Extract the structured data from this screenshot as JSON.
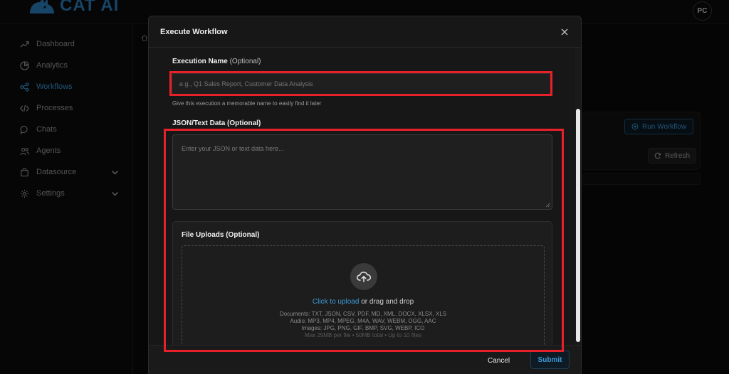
{
  "app": {
    "brand": "CAT AI",
    "avatar_initials": "PC",
    "accent_color": "#3b9ad9",
    "highlight_color": "#e8202a"
  },
  "sidebar": {
    "items": [
      {
        "label": "Dashboard",
        "icon": "trend-up-icon",
        "active": false
      },
      {
        "label": "Analytics",
        "icon": "pie-chart-icon",
        "active": false
      },
      {
        "label": "Workflows",
        "icon": "share-nodes-icon",
        "active": true
      },
      {
        "label": "Processes",
        "icon": "code-icon",
        "active": false
      },
      {
        "label": "Chats",
        "icon": "chat-bubble-icon",
        "active": false
      },
      {
        "label": "Agents",
        "icon": "users-icon",
        "active": false
      },
      {
        "label": "Datasource",
        "icon": "database-bag-icon",
        "active": false,
        "expandable": true
      },
      {
        "label": "Settings",
        "icon": "gear-icon",
        "active": false,
        "expandable": true
      }
    ]
  },
  "background": {
    "run_workflow_label": "Run Workflow",
    "refresh_label": "Refresh"
  },
  "modal": {
    "title": "Execute Workflow",
    "execution_name": {
      "label": "Execution Name",
      "optional": "(Optional)",
      "placeholder": "e.g., Q1 Sales Report, Customer Data Analysis",
      "value": "",
      "hint": "Give this execution a memorable name to easily find it later"
    },
    "json_data": {
      "label": "JSON/Text Data (Optional)",
      "placeholder": "Enter your JSON or text data here...",
      "value": ""
    },
    "file_uploads": {
      "label": "File Uploads (Optional)",
      "click_text": "Click to upload",
      "drag_text": " or drag and drop",
      "documents": "Documents: TXT, JSON, CSV, PDF, MD, XML, DOCX, XLSX, XLS",
      "audio": "Audio: MP3, MP4, MPEG, M4A, WAV, WEBM, OGG, AAC",
      "images": "Images: JPG, PNG, GIF, BMP, SVG, WEBP, ICO",
      "limits": "Max 25MB per file • 50MB total • Up to 10 files"
    },
    "footer": {
      "cancel_label": "Cancel",
      "submit_label": "Submit"
    }
  }
}
